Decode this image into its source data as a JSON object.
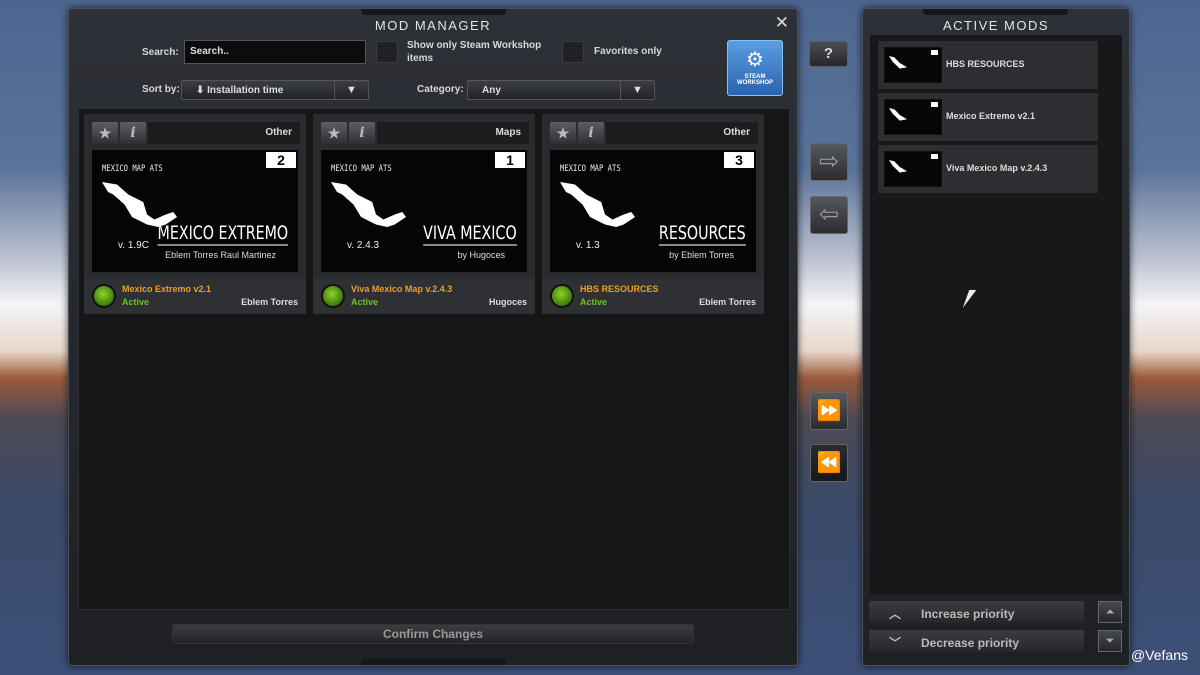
{
  "manager": {
    "title": "MOD MANAGER",
    "close": "✕",
    "search_label": "Search:",
    "search_value": "Search..",
    "steam_only": "Show only Steam Workshop items",
    "favorites_only": "Favorites only",
    "sort_label": "Sort by:",
    "sort_value": "⬇ Installation time",
    "category_label": "Category:",
    "category_value": "Any",
    "workshop_btn": "STEAM WORKSHOP",
    "help": "?",
    "confirm": "Confirm Changes"
  },
  "mods": [
    {
      "category": "Other",
      "order": "2",
      "map_label": "MEXICO MAP ATS",
      "version": "v. 1.9C",
      "logo": "MEXICO EXTREMO",
      "byline": "Eblem Torres   Raul Martinez",
      "name": "Mexico Extremo v2.1",
      "status": "Active",
      "author": "Eblem Torres"
    },
    {
      "category": "Maps",
      "order": "1",
      "map_label": "MEXICO MAP ATS",
      "version": "v. 2.4.3",
      "logo": "VIVA MEXICO",
      "byline": "by Hugoces",
      "name": "Viva Mexico Map v.2.4.3",
      "status": "Active",
      "author": "Hugoces"
    },
    {
      "category": "Other",
      "order": "3",
      "map_label": "MEXICO MAP ATS",
      "version": "v. 1.3",
      "logo": "RESOURCES",
      "byline": "by Eblem Torres",
      "name": "HBS RESOURCES",
      "status": "Active",
      "author": "Eblem Torres"
    }
  ],
  "active": {
    "title": "ACTIVE MODS",
    "items": [
      "HBS RESOURCES",
      "Mexico Extremo v2.1",
      "Viva Mexico Map v.2.4.3"
    ],
    "increase": "Increase priority",
    "decrease": "Decrease priority"
  },
  "watermark": "@Vefans"
}
